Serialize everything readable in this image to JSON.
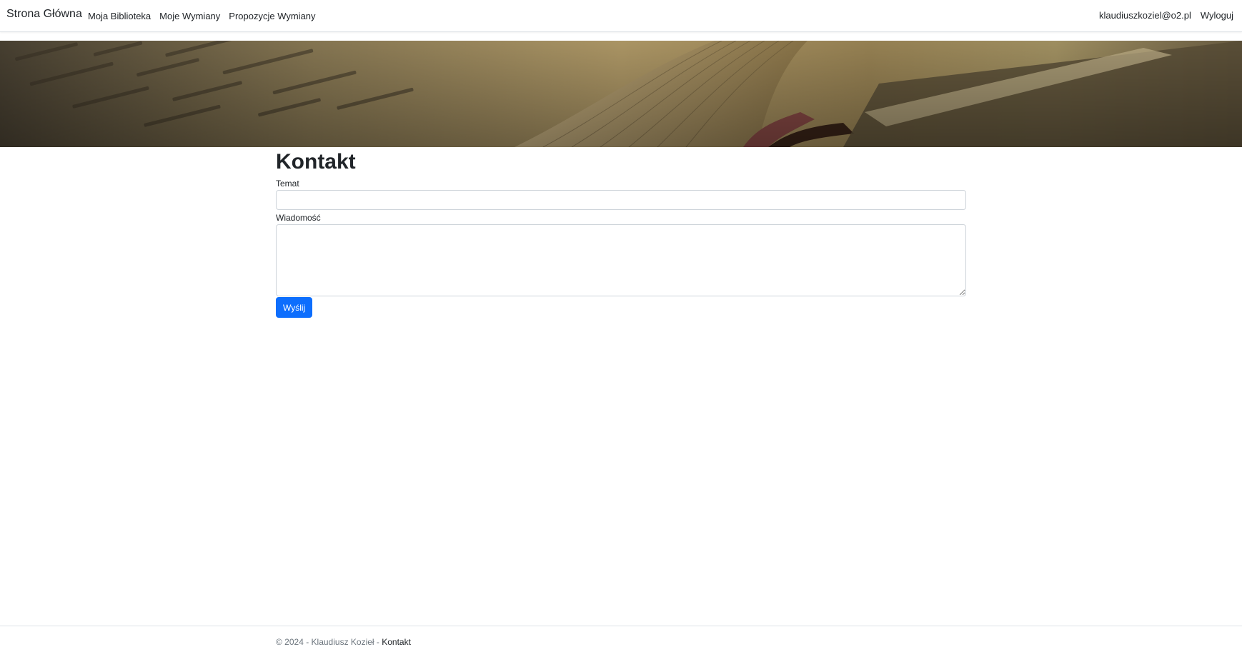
{
  "navbar": {
    "brand": "Strona Główna",
    "left_links": [
      "Moja Biblioteka",
      "Moje Wymiany",
      "Propozycje Wymiany"
    ],
    "user_email": "klaudiuszkoziel@o2.pl",
    "logout": "Wyloguj"
  },
  "banner": {
    "image": "banner-image"
  },
  "main": {
    "title": "Kontakt",
    "subject_label": "Temat",
    "subject_value": "",
    "message_label": "Wiadomość",
    "message_value": "",
    "submit_label": "Wyślij"
  },
  "footer": {
    "copyright": "© 2024 - Klaudiusz Kozieł - ",
    "contact_link": "Kontakt"
  },
  "colors": {
    "accent": "#0d6efd",
    "text": "#212529",
    "muted": "#6c757d",
    "border": "#dee2e6"
  }
}
